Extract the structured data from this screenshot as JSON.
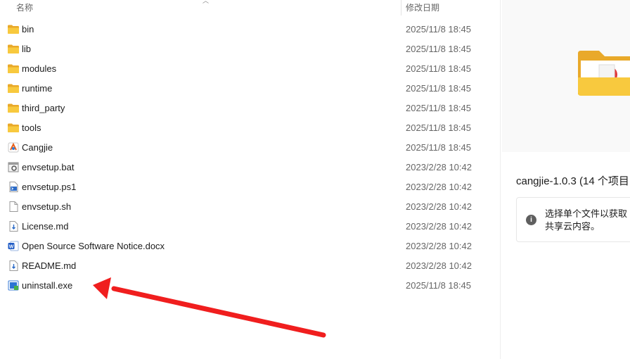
{
  "columns": {
    "name": "名称",
    "date_modified": "修改日期"
  },
  "files": [
    {
      "name": "bin",
      "date": "2025/11/8 18:45",
      "icon": "folder-icon"
    },
    {
      "name": "lib",
      "date": "2025/11/8 18:45",
      "icon": "folder-icon"
    },
    {
      "name": "modules",
      "date": "2025/11/8 18:45",
      "icon": "folder-icon"
    },
    {
      "name": "runtime",
      "date": "2025/11/8 18:45",
      "icon": "folder-icon"
    },
    {
      "name": "third_party",
      "date": "2025/11/8 18:45",
      "icon": "folder-icon"
    },
    {
      "name": "tools",
      "date": "2025/11/8 18:45",
      "icon": "folder-icon"
    },
    {
      "name": "Cangjie",
      "date": "2025/11/8 18:45",
      "icon": "cangjie-app-icon"
    },
    {
      "name": "envsetup.bat",
      "date": "2023/2/28 10:42",
      "icon": "batch-file-icon"
    },
    {
      "name": "envsetup.ps1",
      "date": "2023/2/28 10:42",
      "icon": "powershell-file-icon"
    },
    {
      "name": "envsetup.sh",
      "date": "2023/2/28 10:42",
      "icon": "text-file-icon"
    },
    {
      "name": "License.md",
      "date": "2023/2/28 10:42",
      "icon": "markdown-file-icon"
    },
    {
      "name": "Open Source Software Notice.docx",
      "date": "2023/2/28 10:42",
      "icon": "word-document-icon"
    },
    {
      "name": "README.md",
      "date": "2023/2/28 10:42",
      "icon": "markdown-file-icon"
    },
    {
      "name": "uninstall.exe",
      "date": "2025/11/8 18:45",
      "icon": "installer-exe-icon"
    }
  ],
  "details": {
    "title": "cangjie-1.0.3 (14 个项目",
    "info_line1": "选择单个文件以获取",
    "info_line2": "共享云内容。"
  },
  "colors": {
    "folder_yellow": "#f8c93e",
    "annotation_arrow": "#f01e1e",
    "word_blue": "#1e5bc6"
  }
}
